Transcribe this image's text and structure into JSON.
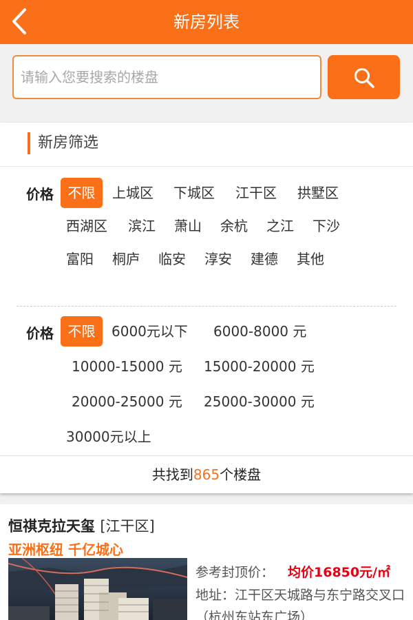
{
  "header": {
    "title": "新房列表",
    "back_icon": "chevron-left-icon"
  },
  "search": {
    "placeholder": "请输入您要搜索的楼盘",
    "value": "",
    "button_icon": "search-icon"
  },
  "filter": {
    "title": "新房筛选",
    "area_row": {
      "label": "价格",
      "options": [
        "不限",
        "上城区",
        "下城区",
        "江干区",
        "拱墅区",
        "西湖区",
        "滨江",
        "萧山",
        "余杭",
        "之江",
        "下沙",
        "富阳",
        "桐庐",
        "临安",
        "淳安",
        "建德",
        "其他"
      ],
      "selected": "不限"
    },
    "price_row": {
      "label": "价格",
      "options": [
        "不限",
        "6000元以下",
        "6000-8000 元",
        "10000-15000 元",
        "15000-20000 元",
        "20000-25000 元",
        "25000-30000 元",
        "30000元以上"
      ],
      "selected": "不限"
    }
  },
  "result": {
    "prefix": "共找到",
    "count": "865",
    "suffix": "个楼盘"
  },
  "listings": [
    {
      "name": "恒祺克拉天玺",
      "district": "[江干区]",
      "slogan": "亚洲枢纽 千亿城心",
      "price_label": "参考封顶价：",
      "price": "均价16850元/㎡",
      "address": "地址：江干区天城路与东宁路交叉口（杭州东站东广场）"
    }
  ],
  "colors": {
    "accent": "#f97019",
    "price": "#e60012"
  }
}
